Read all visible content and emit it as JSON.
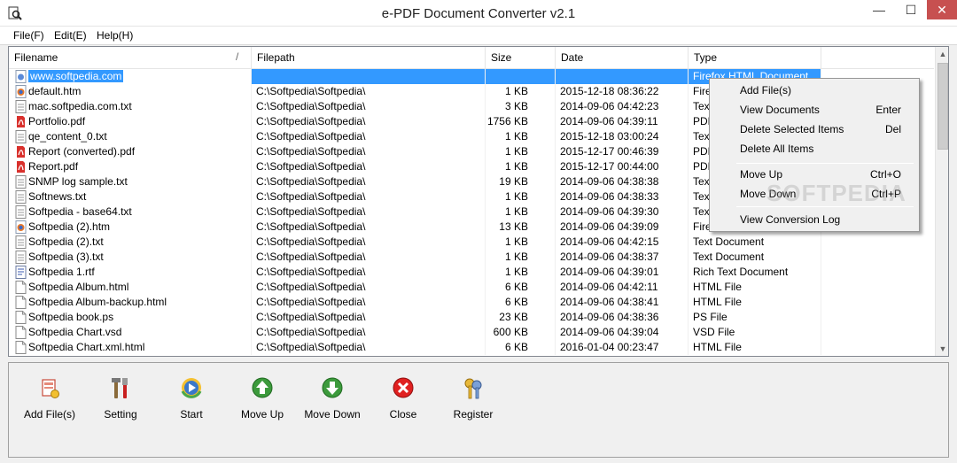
{
  "window": {
    "title": "e-PDF Document Converter v2.1",
    "minimize_glyph": "—",
    "maximize_glyph": "☐",
    "close_glyph": "✕"
  },
  "menu": [
    {
      "label": "File(F)"
    },
    {
      "label": "Edit(E)"
    },
    {
      "label": "Help(H)"
    }
  ],
  "columns": {
    "filename": "Filename",
    "filepath": "Filepath",
    "size": "Size",
    "date": "Date",
    "type": "Type"
  },
  "files": [
    {
      "name": "www.softpedia.com",
      "path": "",
      "size": "",
      "date": "",
      "type": "Firefox HTML Document",
      "icon": "url-icon",
      "selected": true
    },
    {
      "name": "default.htm",
      "path": "C:\\Softpedia\\Softpedia\\",
      "size": "1 KB",
      "date": "2015-12-18 08:36:22",
      "type": "Fire",
      "icon": "firefox-icon"
    },
    {
      "name": "mac.softpedia.com.txt",
      "path": "C:\\Softpedia\\Softpedia\\",
      "size": "3 KB",
      "date": "2014-09-06 04:42:23",
      "type": "Text",
      "icon": "text-file-icon"
    },
    {
      "name": "Portfolio.pdf",
      "path": "C:\\Softpedia\\Softpedia\\",
      "size": "1756 KB",
      "date": "2014-09-06 04:39:11",
      "type": "PDF",
      "icon": "pdf-icon"
    },
    {
      "name": "qe_content_0.txt",
      "path": "C:\\Softpedia\\Softpedia\\",
      "size": "1 KB",
      "date": "2015-12-18 03:00:24",
      "type": "Text",
      "icon": "text-file-icon"
    },
    {
      "name": "Report (converted).pdf",
      "path": "C:\\Softpedia\\Softpedia\\",
      "size": "1 KB",
      "date": "2015-12-17 00:46:39",
      "type": "PDF",
      "icon": "pdf-icon"
    },
    {
      "name": "Report.pdf",
      "path": "C:\\Softpedia\\Softpedia\\",
      "size": "1 KB",
      "date": "2015-12-17 00:44:00",
      "type": "PDF",
      "icon": "pdf-icon"
    },
    {
      "name": "SNMP log sample.txt",
      "path": "C:\\Softpedia\\Softpedia\\",
      "size": "19 KB",
      "date": "2014-09-06 04:38:38",
      "type": "Text",
      "icon": "text-file-icon"
    },
    {
      "name": "Softnews.txt",
      "path": "C:\\Softpedia\\Softpedia\\",
      "size": "1 KB",
      "date": "2014-09-06 04:38:33",
      "type": "Text",
      "icon": "text-file-icon"
    },
    {
      "name": "Softpedia - base64.txt",
      "path": "C:\\Softpedia\\Softpedia\\",
      "size": "1 KB",
      "date": "2014-09-06 04:39:30",
      "type": "Text",
      "icon": "text-file-icon"
    },
    {
      "name": "Softpedia (2).htm",
      "path": "C:\\Softpedia\\Softpedia\\",
      "size": "13 KB",
      "date": "2014-09-06 04:39:09",
      "type": "Fire",
      "icon": "firefox-icon"
    },
    {
      "name": "Softpedia (2).txt",
      "path": "C:\\Softpedia\\Softpedia\\",
      "size": "1 KB",
      "date": "2014-09-06 04:42:15",
      "type": "Text Document",
      "icon": "text-file-icon"
    },
    {
      "name": "Softpedia (3).txt",
      "path": "C:\\Softpedia\\Softpedia\\",
      "size": "1 KB",
      "date": "2014-09-06 04:38:37",
      "type": "Text Document",
      "icon": "text-file-icon"
    },
    {
      "name": "Softpedia 1.rtf",
      "path": "C:\\Softpedia\\Softpedia\\",
      "size": "1 KB",
      "date": "2014-09-06 04:39:01",
      "type": "Rich Text Document",
      "icon": "rtf-icon"
    },
    {
      "name": "Softpedia Album.html",
      "path": "C:\\Softpedia\\Softpedia\\",
      "size": "6 KB",
      "date": "2014-09-06 04:42:11",
      "type": "HTML File",
      "icon": "blank-file-icon"
    },
    {
      "name": "Softpedia Album-backup.html",
      "path": "C:\\Softpedia\\Softpedia\\",
      "size": "6 KB",
      "date": "2014-09-06 04:38:41",
      "type": "HTML File",
      "icon": "blank-file-icon"
    },
    {
      "name": "Softpedia book.ps",
      "path": "C:\\Softpedia\\Softpedia\\",
      "size": "23 KB",
      "date": "2014-09-06 04:38:36",
      "type": "PS File",
      "icon": "blank-file-icon"
    },
    {
      "name": "Softpedia Chart.vsd",
      "path": "C:\\Softpedia\\Softpedia\\",
      "size": "600 KB",
      "date": "2014-09-06 04:39:04",
      "type": "VSD File",
      "icon": "blank-file-icon"
    },
    {
      "name": "Softpedia Chart.xml.html",
      "path": "C:\\Softpedia\\Softpedia\\",
      "size": "6 KB",
      "date": "2016-01-04 00:23:47",
      "type": "HTML File",
      "icon": "blank-file-icon"
    }
  ],
  "context_menu": {
    "items": [
      {
        "label": "Add File(s)",
        "shortcut": ""
      },
      {
        "label": "View Documents",
        "shortcut": "Enter"
      },
      {
        "label": "Delete Selected Items",
        "shortcut": "Del"
      },
      {
        "label": "Delete All Items",
        "shortcut": ""
      },
      {
        "label": "Move Up",
        "shortcut": "Ctrl+O"
      },
      {
        "label": "Move Down",
        "shortcut": "Ctrl+P"
      },
      {
        "label": "View Conversion Log",
        "shortcut": ""
      }
    ]
  },
  "toolbar": {
    "buttons": [
      {
        "label": "Add File(s)",
        "icon": "add-files-icon"
      },
      {
        "label": "Setting",
        "icon": "tools-icon"
      },
      {
        "label": "Start",
        "icon": "start-icon"
      },
      {
        "label": "Move Up",
        "icon": "move-up-icon"
      },
      {
        "label": "Move Down",
        "icon": "move-down-icon"
      },
      {
        "label": "Close",
        "icon": "close-icon"
      },
      {
        "label": "Register",
        "icon": "register-keys-icon"
      }
    ]
  },
  "watermark": "SOFTPEDIA",
  "colors": {
    "selection": "#3399ff",
    "close_button": "#c75050",
    "pdf_red": "#d9302c",
    "arrow_green": "#3c9a3c",
    "close_red": "#e02020"
  }
}
